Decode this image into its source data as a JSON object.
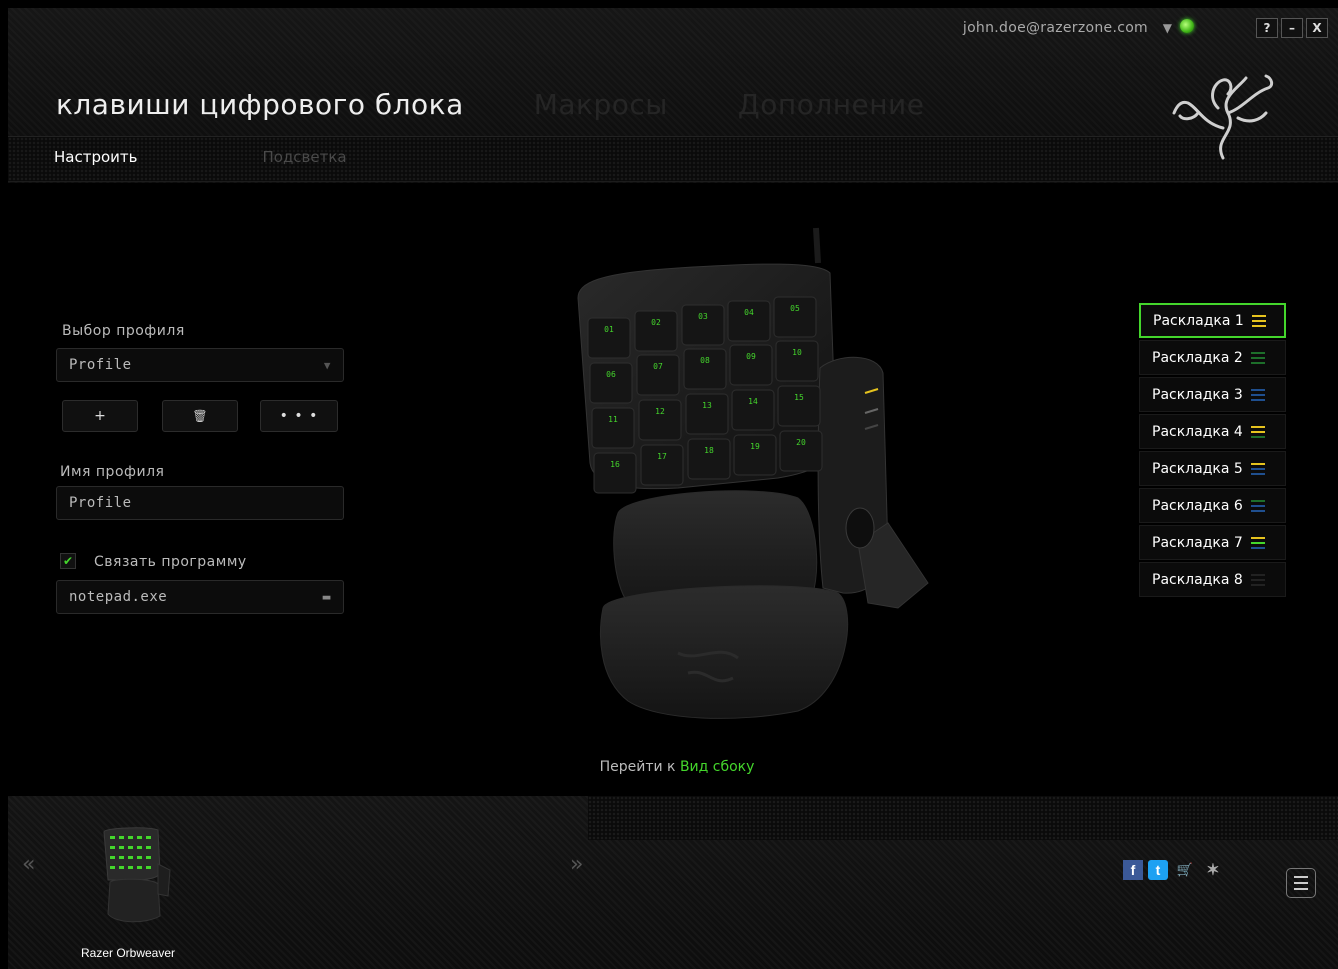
{
  "header": {
    "account_email": "john.doe@razerzone.com",
    "window_buttons": [
      "?",
      "–",
      "X"
    ],
    "main_tabs": [
      {
        "label": "клавиши цифрового блока",
        "active": true
      },
      {
        "label": "Макросы",
        "active": false
      },
      {
        "label": "Дополнение",
        "active": false
      }
    ],
    "sub_tabs": [
      {
        "label": "Настроить",
        "active": true
      },
      {
        "label": "Подсветка",
        "active": false
      }
    ]
  },
  "profile": {
    "select_label": "Выбор профиля",
    "selected_profile": "Profile",
    "add_label": "+",
    "delete_label": "🗑",
    "more_label": "• • •",
    "name_label": "Имя профиля",
    "name_value": "Profile",
    "link_program_label": "Связать программу",
    "link_program_checked": true,
    "program_value": "notepad.exe"
  },
  "keypad": {
    "keys": [
      "01",
      "02",
      "03",
      "04",
      "05",
      "06",
      "07",
      "08",
      "09",
      "10",
      "11",
      "12",
      "13",
      "14",
      "15",
      "16",
      "17",
      "18",
      "19",
      "20"
    ],
    "accent_color": "#44d62c"
  },
  "layouts": [
    {
      "label": "Раскладка 1",
      "colors": [
        "#e6c31e",
        "#e6c31e",
        "#e6c31e"
      ],
      "active": true
    },
    {
      "label": "Раскладка 2",
      "colors": [
        "#1d6e2a",
        "#1d6e2a",
        "#1d6e2a"
      ],
      "active": false
    },
    {
      "label": "Раскладка 3",
      "colors": [
        "#1f4f8f",
        "#1f4f8f",
        "#1f4f8f"
      ],
      "active": false
    },
    {
      "label": "Раскладка 4",
      "colors": [
        "#e6c31e",
        "#e6c31e",
        "#1d6e2a"
      ],
      "active": false
    },
    {
      "label": "Раскладка 5",
      "colors": [
        "#e6c31e",
        "#1f4f8f",
        "#1f4f8f"
      ],
      "active": false
    },
    {
      "label": "Раскладка 6",
      "colors": [
        "#1d6e2a",
        "#1f4f8f",
        "#1f4f8f"
      ],
      "active": false
    },
    {
      "label": "Раскладка 7",
      "colors": [
        "#e6c31e",
        "#44d62c",
        "#1f4f8f"
      ],
      "active": false
    },
    {
      "label": "Раскладка 8",
      "colors": [
        "#222222",
        "#222222",
        "#222222"
      ],
      "active": false
    }
  ],
  "goto": {
    "prefix": "Перейти к",
    "link": "Вид сбоку"
  },
  "footer": {
    "device_name": "Razer Orbweaver",
    "prev_arrow": "«",
    "next_arrow": "»",
    "social": [
      {
        "icon": "facebook-icon",
        "glyph": "f",
        "color": "#3b5998"
      },
      {
        "icon": "twitter-icon",
        "glyph": "t",
        "color": "#1da1f2"
      },
      {
        "icon": "cart-icon",
        "glyph": "🛒",
        "color": "#999999"
      },
      {
        "icon": "razer-icon",
        "glyph": "✶",
        "color": "#999999"
      }
    ]
  }
}
